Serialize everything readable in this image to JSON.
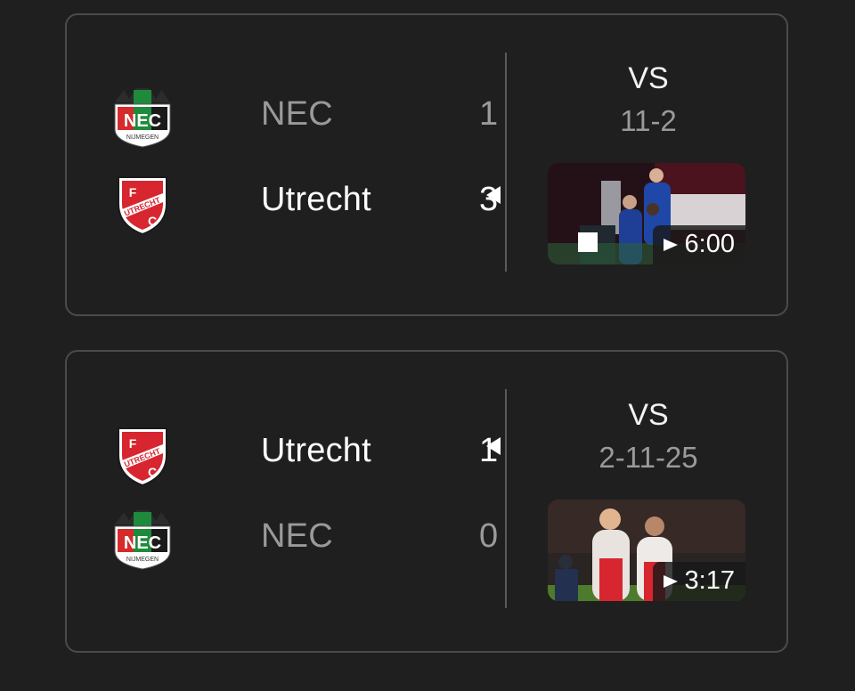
{
  "matches": [
    {
      "home": {
        "name": "NEC",
        "logo": "nec-nijmegen-logo",
        "score": "1",
        "winner": false
      },
      "away": {
        "name": "Utrecht",
        "logo": "fc-utrecht-logo",
        "score": "3",
        "winner": true
      },
      "vs_label": "VS",
      "date": "11-2",
      "video": {
        "duration": "6:00",
        "play_icon": "play-icon"
      }
    },
    {
      "home": {
        "name": "Utrecht",
        "logo": "fc-utrecht-logo",
        "score": "1",
        "winner": true
      },
      "away": {
        "name": "NEC",
        "logo": "nec-nijmegen-logo",
        "score": "0",
        "winner": false
      },
      "vs_label": "VS",
      "date": "2-11-25",
      "video": {
        "duration": "3:17",
        "play_icon": "play-icon"
      }
    }
  ],
  "logo_texts": {
    "nec": "NEC",
    "nec_sub": "NIJMEGEN",
    "utrecht": "UTRECHT",
    "utrecht_f": "F",
    "utrecht_c": "C"
  },
  "colors": {
    "background": "#1f1f1f",
    "card_border": "#4b4b4c",
    "winner_text": "#ffffff",
    "loser_text": "#9a9a9a",
    "utrecht_red": "#d7262f",
    "nec_green": "#1e8a3c",
    "nec_red": "#d52b2b"
  }
}
